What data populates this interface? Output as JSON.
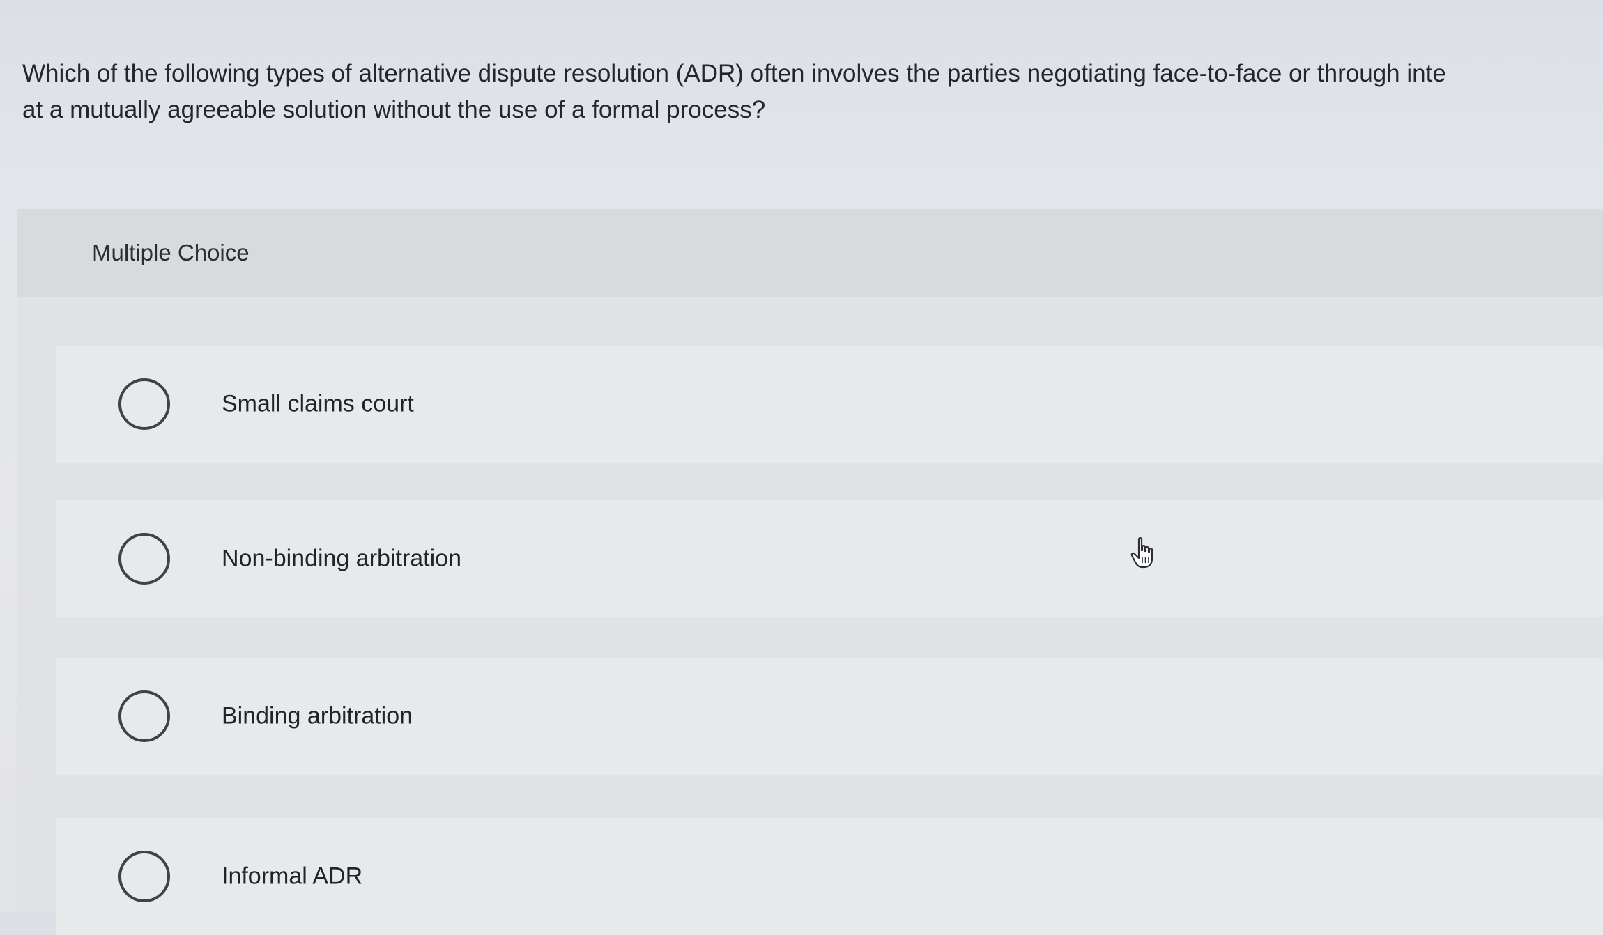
{
  "question": {
    "line1": "Which of the following types of alternative dispute resolution (ADR) often involves the parties negotiating face-to-face or through inte",
    "line2": "at a mutually agreeable solution without the use of a formal process?"
  },
  "question_type": "Multiple Choice",
  "choices": [
    {
      "label": "Small claims court",
      "selected": false
    },
    {
      "label": "Non-binding arbitration",
      "selected": false
    },
    {
      "label": "Binding arbitration",
      "selected": false
    },
    {
      "label": "Informal ADR",
      "selected": false
    }
  ],
  "cursor_icon": "hand-pointer-icon"
}
